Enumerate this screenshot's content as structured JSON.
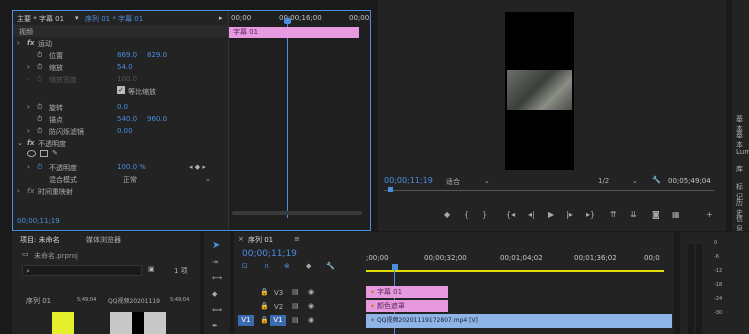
{
  "effect_controls": {
    "source_label": "主要 * 字幕 01",
    "sequence_label": "序列 01 * 字幕 01",
    "section_video": "视频",
    "motion": "运动",
    "position_label": "位置",
    "position_x": "869.0",
    "position_y": "829.0",
    "scale_label": "缩放",
    "scale_value": "54.0",
    "scale_width_label": "缩放宽度",
    "scale_width_value": "100.0",
    "uniform_scale_label": "等比缩放",
    "rotation_label": "旋转",
    "rotation_value": "0.0",
    "anchor_label": "锚点",
    "anchor_x": "540.0",
    "anchor_y": "960.0",
    "flicker_label": "防闪烁滤镜",
    "flicker_value": "0.00",
    "opacity_section": "不透明度",
    "opacity_label": "不透明度",
    "opacity_value": "100.0 %",
    "blend_label": "混合模式",
    "blend_value": "正常",
    "time_remap": "时间重映射",
    "timecode": "00;00;11;19",
    "ruler": [
      "00;00",
      "00;00;16;00",
      "00;00;32"
    ],
    "clip_label": "字幕 01"
  },
  "program_monitor": {
    "timecode": "00;00;11;19",
    "fit_label": "适合",
    "quality": "1/2",
    "duration": "00;05;49;04"
  },
  "right_panel": {
    "items": [
      "基本",
      "基本",
      "Lum",
      "库",
      "标记",
      "历史",
      "信息"
    ]
  },
  "project_panel": {
    "tab_project": "项目: 未命名",
    "tab_media": "媒体浏览器",
    "file_name": "未命名.prproj",
    "item_count": "1 项",
    "items": [
      {
        "name": "序列 01",
        "duration": "5;49;04"
      },
      {
        "name": "QQ视频20201119",
        "duration": "5;49;04"
      }
    ]
  },
  "timeline": {
    "tab_label": "序列 01",
    "timecode": "00;00;11;19",
    "ruler": [
      ";00;00",
      "00;00;32;00",
      "00;01;04;02",
      "00;01;36;02",
      "00;0"
    ],
    "tracks": [
      {
        "target": "",
        "name": "V3"
      },
      {
        "target": "",
        "name": "V2"
      },
      {
        "target": "V1",
        "name": "V1"
      }
    ],
    "clips": [
      {
        "label": "字幕 01"
      },
      {
        "label": "颜色遮罩"
      },
      {
        "label": "QQ视频20201119172807.mp4 [V]"
      }
    ]
  },
  "audio_meter": {
    "ticks": [
      "0",
      "-6",
      "-12",
      "-18",
      "-24",
      "-30"
    ]
  },
  "colors": {
    "accent": "#4a8fe0",
    "clip_pink": "#e89ae0",
    "clip_blue": "#8fb4e8",
    "panel_bg": "#232323"
  }
}
